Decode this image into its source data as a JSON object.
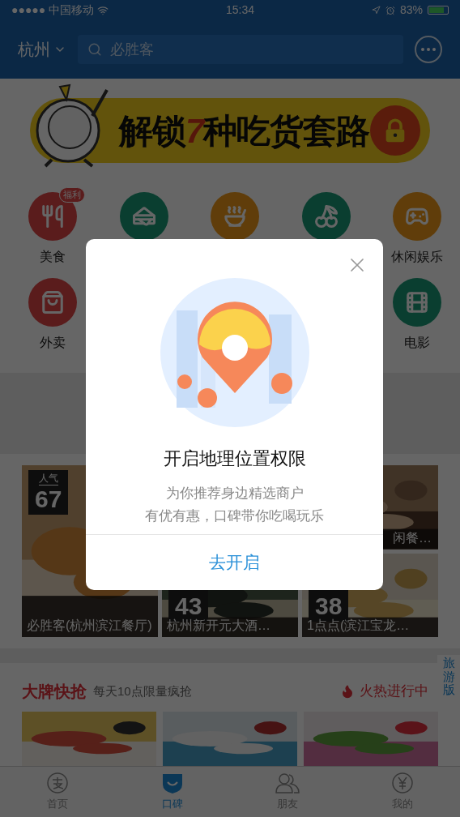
{
  "status_bar": {
    "carrier": "●●●●● 中国移动",
    "time": "15:34",
    "battery": "83%"
  },
  "nav": {
    "city": "杭州",
    "search_placeholder": "必胜客"
  },
  "banner": {
    "before": "解锁",
    "highlight": "7",
    "after": "种吃货套路"
  },
  "category_rows": [
    [
      {
        "label": "美食",
        "badge": "福利"
      },
      {},
      {},
      {},
      {
        "label": "休闲娱乐"
      }
    ],
    [
      {
        "label": "外卖"
      },
      {
        "label": "电影"
      }
    ]
  ],
  "cards": [
    {
      "badge_label": "人气",
      "rank": "67",
      "name": "必胜客(杭州滨江餐厅)"
    },
    {
      "name": "闲餐…"
    },
    {
      "rank": "43",
      "name": "杭州新开元大酒…"
    },
    {
      "rank": "38",
      "name": "1点点(滨江宝龙…"
    }
  ],
  "deals": {
    "title": "大牌快抢",
    "subtitle": "每天10点限量疯抢",
    "hot": "火热进行中"
  },
  "side_tab": "旅游版",
  "tabs": [
    {
      "label": "首页",
      "selected": false
    },
    {
      "label": "口碑",
      "selected": true
    },
    {
      "label": "朋友",
      "selected": false
    },
    {
      "label": "我的",
      "selected": false
    }
  ],
  "dialog": {
    "title": "开启地理位置权限",
    "lines": [
      "为你推荐身边精选商户",
      "有优有惠，口碑带你吃喝玩乐"
    ],
    "button": "去开启"
  }
}
